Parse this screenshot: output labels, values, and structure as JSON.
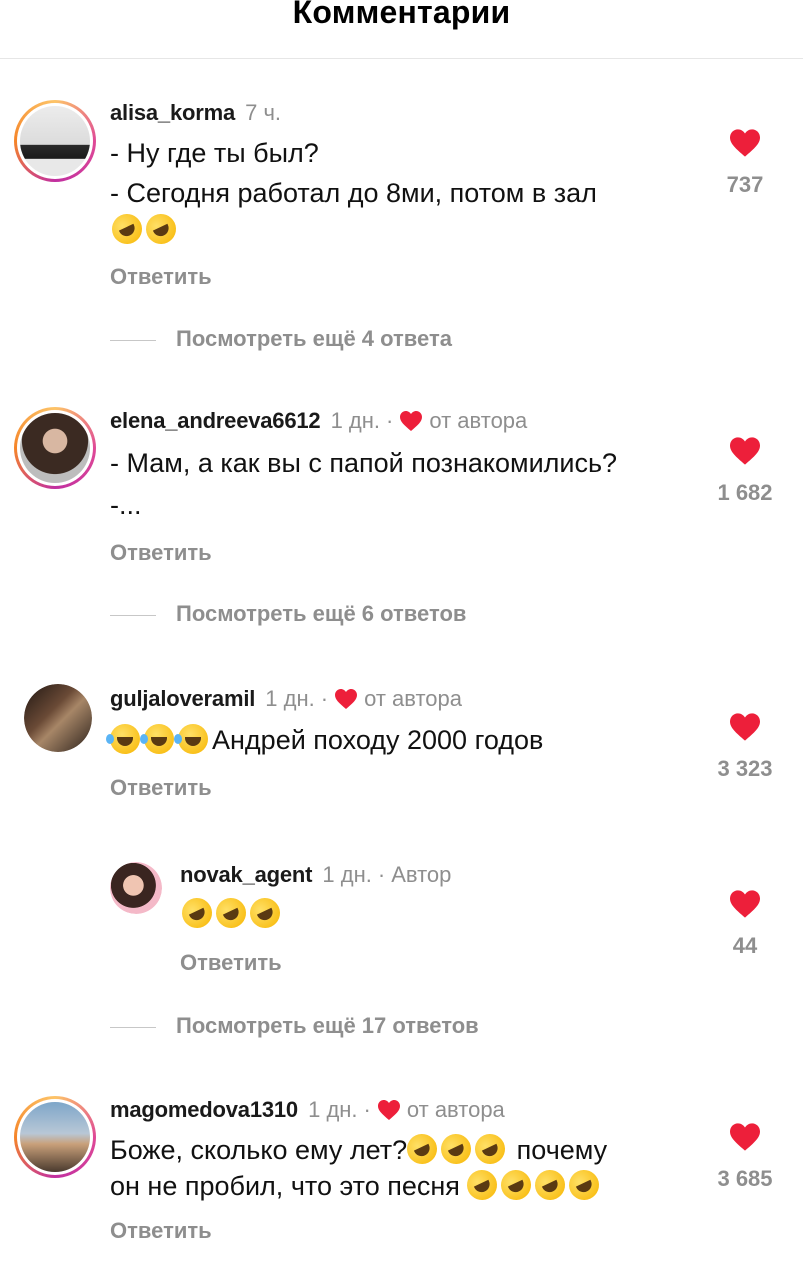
{
  "header": {
    "title": "Комментарии"
  },
  "reply_label": "Ответить",
  "colors": {
    "heart": "#ed1f3a",
    "muted": "#8e8e8e"
  },
  "comments": [
    {
      "username": "alisa_korma",
      "time": "7 ч.",
      "lines": [
        "- Ну где ты был?",
        "- Сегодня работал до 8ми, потом в зал"
      ],
      "emoji_line": [
        "rofl",
        "rofl"
      ],
      "likes": "737",
      "view_more": "Посмотреть ещё 4 ответа"
    },
    {
      "username": "elena_andreeva6612",
      "time": "1 дн.",
      "author_liked": "от автора",
      "lines": [
        "- Мам, а как вы с папой познакомились?",
        "-..."
      ],
      "likes": "1 682",
      "view_more": "Посмотреть ещё 6 ответов"
    },
    {
      "username": "guljaloveramil",
      "time": "1 дн.",
      "author_liked": "от автора",
      "text_after_emoji": "Андрей походу 2000 годов",
      "emoji_prefix": [
        "joy",
        "joy",
        "joy"
      ],
      "likes": "3 323"
    },
    {
      "username": "novak_agent",
      "time": "1 дн.",
      "author_tag": "Автор",
      "emoji_line": [
        "rofl",
        "rofl",
        "rofl"
      ],
      "likes": "44",
      "view_more": "Посмотреть ещё 17 ответов"
    },
    {
      "username": "magomedova1310",
      "time": "1 дн.",
      "author_liked": "от автора",
      "line1_text": "Боже, сколько ему лет?",
      "line1_after": "почему",
      "line2_text": "он не пробил, что это  песня",
      "likes": "3 685"
    }
  ]
}
